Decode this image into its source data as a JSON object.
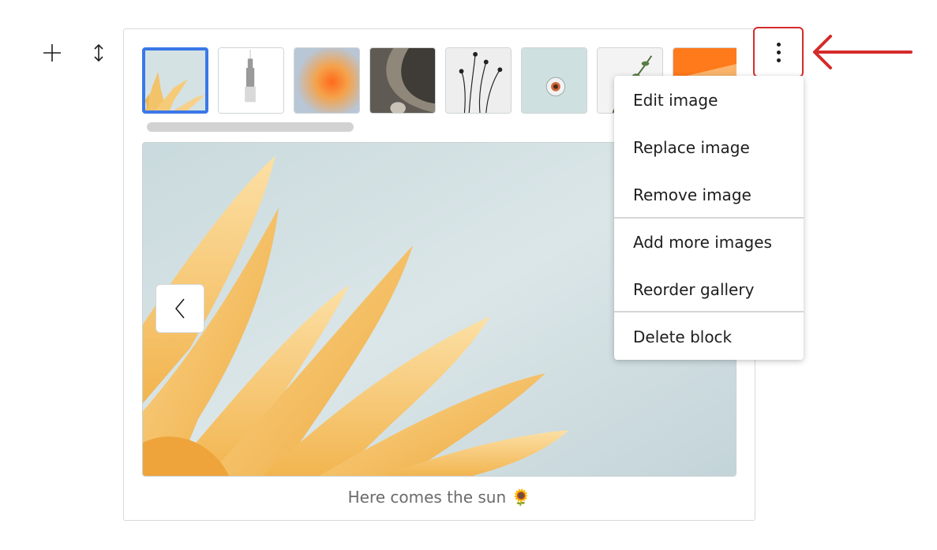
{
  "toolbar": {
    "add_icon": "plus-icon",
    "move_icon": "move-arrows-icon",
    "options_icon": "more-vertical-icon"
  },
  "gallery": {
    "thumbnails": [
      {
        "name": "sunflower-petals",
        "selected": true
      },
      {
        "name": "empire-state-building",
        "selected": false
      },
      {
        "name": "orange-blur",
        "selected": false
      },
      {
        "name": "vase-on-gray",
        "selected": false
      },
      {
        "name": "dried-flowers",
        "selected": false
      },
      {
        "name": "coffee-cup",
        "selected": false
      },
      {
        "name": "plant-sprig",
        "selected": false
      },
      {
        "name": "orange-abstract",
        "selected": false
      }
    ],
    "prev_icon": "chevron-left-icon",
    "caption": "Here comes the sun 🌻"
  },
  "menu": {
    "items": [
      {
        "label": "Edit image"
      },
      {
        "label": "Replace image"
      },
      {
        "label": "Remove image"
      },
      {
        "label": "Add more images"
      },
      {
        "label": "Reorder gallery"
      },
      {
        "label": "Delete block"
      }
    ]
  },
  "annotation": {
    "arrow_icon": "arrow-left-icon",
    "color": "#d42b2b"
  },
  "colors": {
    "selected_border": "#3b78e7",
    "petal": "#f7c66d",
    "sky": "#d7e4e6"
  }
}
